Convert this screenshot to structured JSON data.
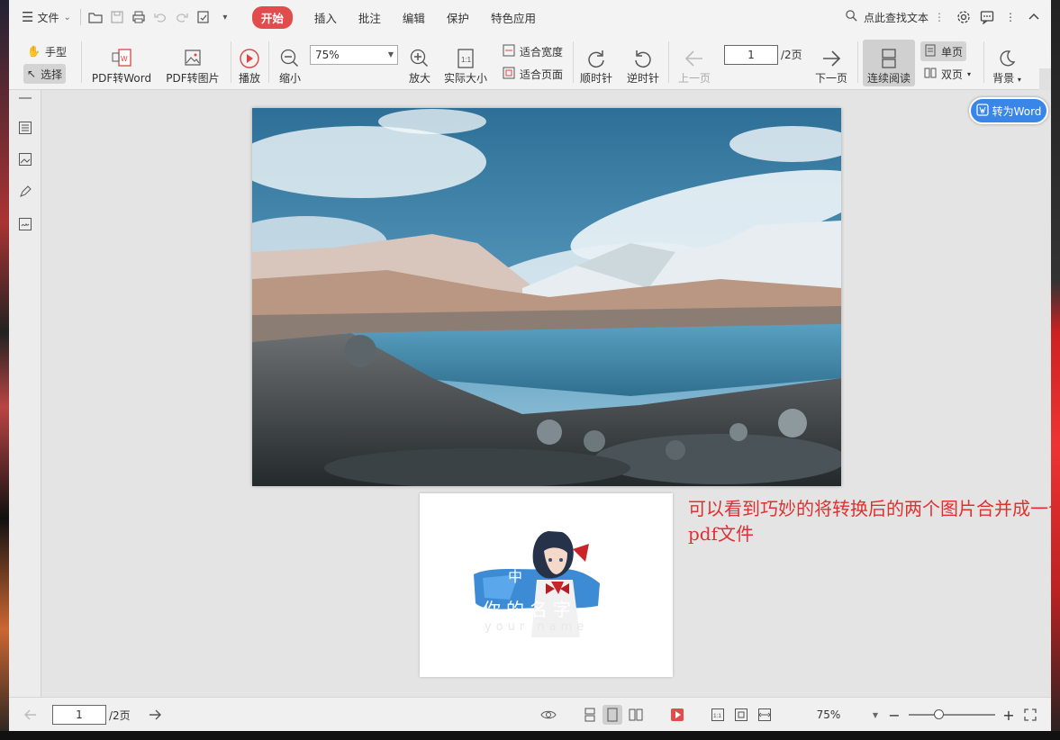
{
  "menubar": {
    "file_label": "文件",
    "tabs": [
      {
        "label": "开始",
        "active": true
      },
      {
        "label": "插入"
      },
      {
        "label": "批注"
      },
      {
        "label": "编辑"
      },
      {
        "label": "保护"
      },
      {
        "label": "特色应用"
      }
    ],
    "search_label": "点此查找文本"
  },
  "ribbon": {
    "hand_label": "手型",
    "select_label": "选择",
    "pdf_to_word_label": "PDF转Word",
    "pdf_to_image_label": "PDF转图片",
    "play_label": "播放",
    "zoom_out_label": "缩小",
    "zoom_value": "75%",
    "zoom_in_label": "放大",
    "actual_size_label": "实际大小",
    "fit_width_label": "适合宽度",
    "fit_page_label": "适合页面",
    "rotate_cw_label": "顺时针",
    "rotate_ccw_label": "逆时针",
    "prev_page_label": "上一页",
    "page_number": "1",
    "page_total": "/2页",
    "next_page_label": "下一页",
    "continuous_label": "连续阅读",
    "single_page_label": "单页",
    "double_page_label": "双页",
    "background_label": "背景"
  },
  "document": {
    "convert_word_label": "转为Word",
    "annotation_text": "可以看到巧妙的将转换后的两个图片合并成一个pdf文件",
    "poster_title": "你的名字",
    "poster_subtitle": "your name",
    "poster_char": "中"
  },
  "status": {
    "page_number": "1",
    "page_total": "/2页",
    "zoom_value": "75%",
    "zoom_fraction": 0.35
  },
  "colors": {
    "accent_red": "#e24c4c",
    "annotation_red": "#e03030",
    "convert_blue": "#3a86e8"
  }
}
